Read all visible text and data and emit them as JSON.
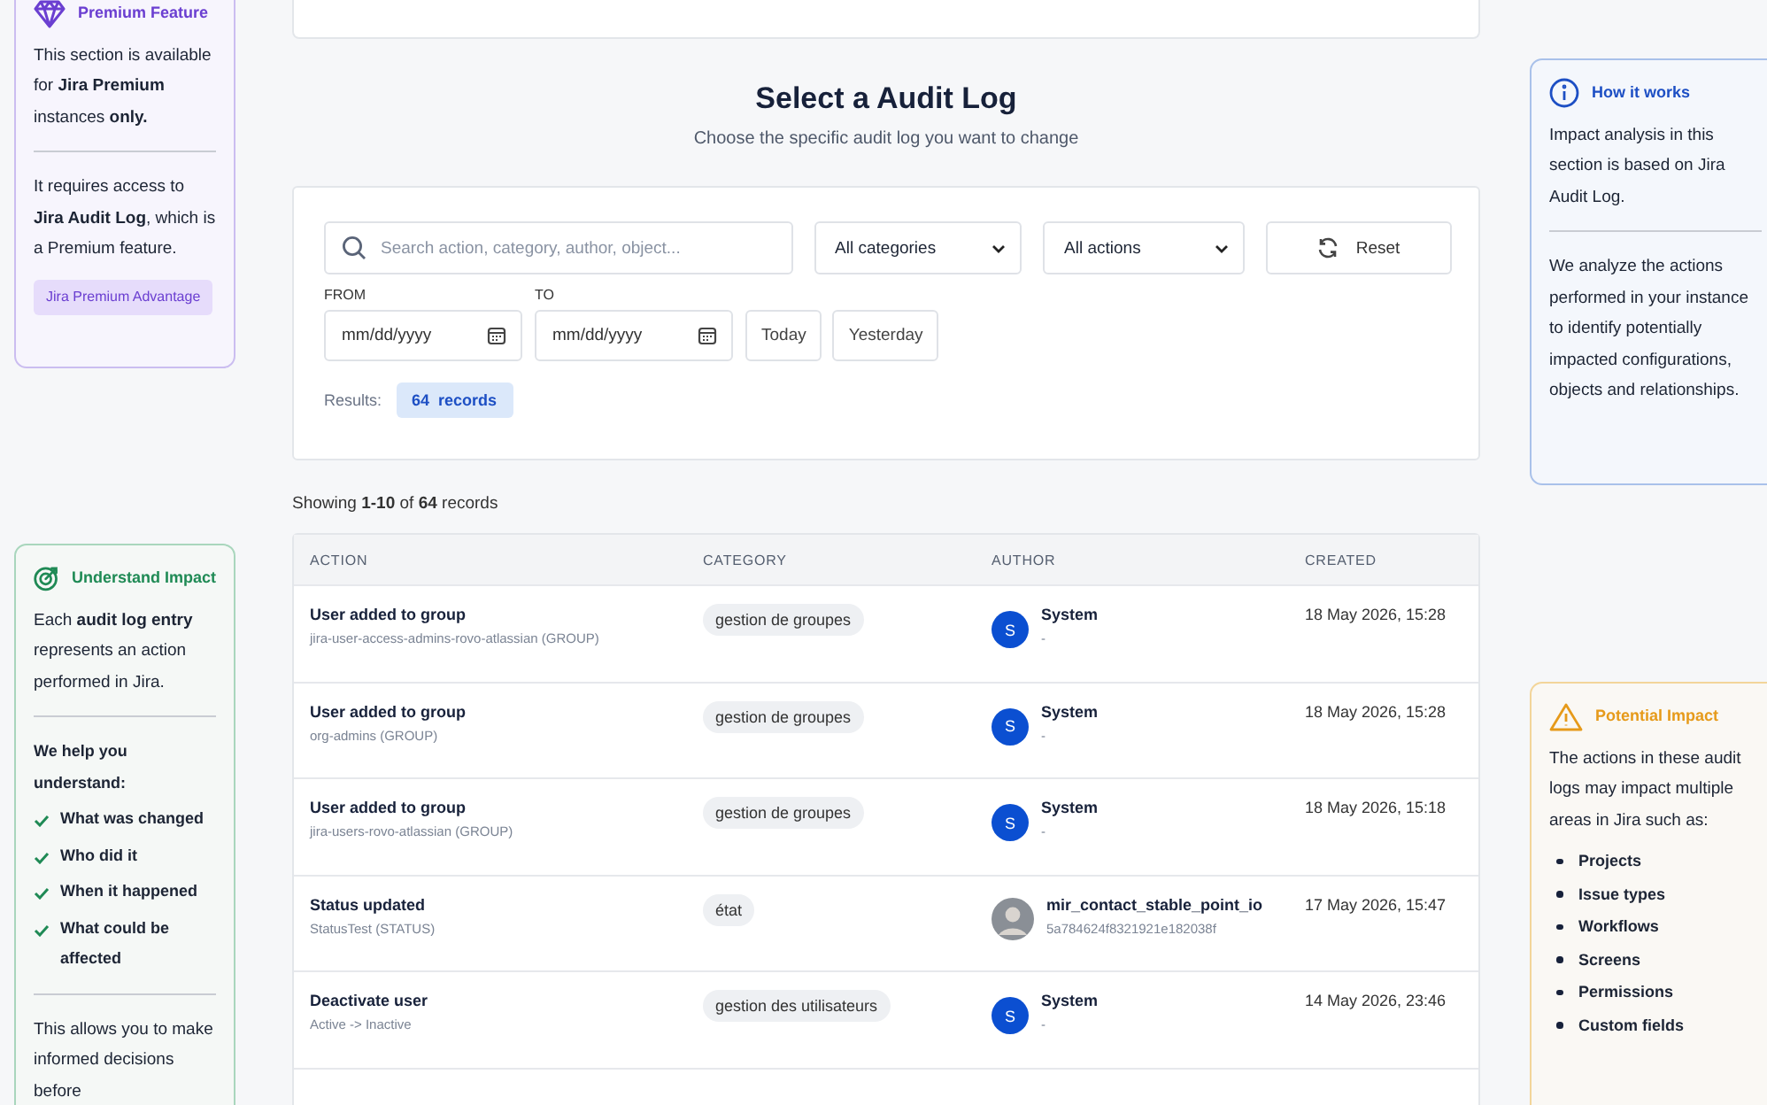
{
  "premium_panel": {
    "title": "Premium Feature",
    "paragraphs": [
      "This section is available for **Jira Premium** instances **only.**",
      "It requires access to **Jira Audit Log**, which is a Premium feature."
    ],
    "tag": "Jira Premium Advantage"
  },
  "impact_panel": {
    "title": "Understand Impact",
    "intro": "Each **audit log entry** represents an action performed in Jira.",
    "lead": "We help you understand:",
    "checks": [
      "What was changed",
      "Who did it",
      "When it happened",
      "What could be affected"
    ],
    "footer": "This allows you to make informed decisions before"
  },
  "heading": {
    "title": "Select a Audit Log",
    "subtitle": "Choose the specific audit log you want to change"
  },
  "filters": {
    "search": {
      "placeholder": "Search action, category, author, object..."
    },
    "category_select": "All categories",
    "action_select": "All actions",
    "reset": "Reset",
    "from": {
      "label": "FROM",
      "placeholder": "mm/dd/yyyy"
    },
    "to": {
      "label": "TO",
      "placeholder": "mm/dd/yyyy"
    },
    "quick": [
      "Today",
      "Yesterday"
    ],
    "results_label": "Results:",
    "results_badge": "64  records"
  },
  "showing": "Showing **1-10** of **64** records",
  "table": {
    "columns": [
      "ACTION",
      "CATEGORY",
      "AUTHOR",
      "CREATED"
    ],
    "rows": [
      {
        "action": "User added to group",
        "object": "jira-user-access-admins-rovo-atlassian (GROUP)",
        "category": "gestion de groupes",
        "author": {
          "kind": "system",
          "initial": "S",
          "name": "System",
          "sub": "-"
        },
        "created": "18 May 2026, 15:28"
      },
      {
        "action": "User added to group",
        "object": "org-admins (GROUP)",
        "category": "gestion de groupes",
        "author": {
          "kind": "system",
          "initial": "S",
          "name": "System",
          "sub": "-"
        },
        "created": "18 May 2026, 15:28"
      },
      {
        "action": "User added to group",
        "object": "jira-users-rovo-atlassian (GROUP)",
        "category": "gestion de groupes",
        "author": {
          "kind": "system",
          "initial": "S",
          "name": "System",
          "sub": "-"
        },
        "created": "18 May 2026, 15:18"
      },
      {
        "action": "Status updated",
        "object": "StatusTest (STATUS)",
        "category": "état",
        "author": {
          "kind": "photo",
          "name": "mir_contact_stable_point_io",
          "sub": "5a784624f8321921e182038f"
        },
        "created": "17 May 2026, 15:47"
      },
      {
        "action": "Deactivate user",
        "object": "Active -> Inactive",
        "category": "gestion des utilisateurs",
        "author": {
          "kind": "system",
          "initial": "S",
          "name": "System",
          "sub": "-"
        },
        "created": "14 May 2026, 23:46"
      }
    ]
  },
  "how_panel": {
    "title": "How it works",
    "paragraphs": [
      "Impact analysis in this section is based on Jira Audit Log.",
      "We analyze the actions performed in your instance to identify potentially impacted configurations, objects and relationships."
    ]
  },
  "potential_panel": {
    "title": "Potential Impact",
    "intro": "The actions in these audit logs may impact multiple areas in Jira such as:",
    "items": [
      "Projects",
      "Issue types",
      "Workflows",
      "Screens",
      "Permissions",
      "Custom fields"
    ]
  }
}
